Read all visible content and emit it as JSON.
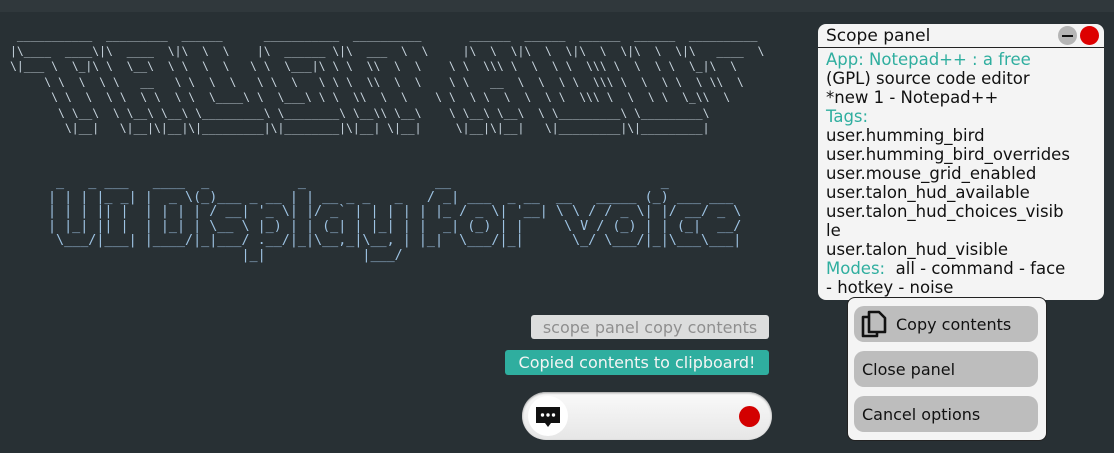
{
  "banner": {
    "title_art": [
      " ___________  _________  ______      ___________  __________       ______  ______  ______  ______  __________",
      "|\\____  ____\\|\\  ____  \\|\\  \\  \\    |\\  ______ \\|\\  ___  \\  \\     |\\  \\  \\|\\  \\  \\|\\  \\  \\|\\  \\  \\|\\   ____  \\",
      "\\|___ \\  \\_|\\ \\  \\__\\  \\ \\  \\  \\   \\ \\  \\___|\\ \\ \\  \\\\  \\  \\    \\ \\  \\\\\\ \\  \\  \\ \\  \\\\\\ \\  \\  \\ \\  \\_|\\  \\",
      "     \\ \\  \\  \\ \\   __   \\ \\  \\  \\   \\ \\  \\   \\ \\ \\  \\\\  \\  \\    \\ \\   __  \\  \\  \\ \\  \\\\\\ \\  \\  \\ \\  \\ \\\\  \\",
      "      \\ \\  \\  \\ \\  \\ \\  \\ \\  \\____\\ \\  \\___\\ \\ \\  \\\\  \\  \\    \\ \\  \\ \\  \\  \\  \\ \\  \\\\\\ \\  \\  \\ \\  \\_\\\\  \\",
      "       \\ \\__\\  \\ \\__\\ \\__\\ \\_________\\ \\________\\ \\__\\\\ \\__\\    \\ \\__\\ \\__\\  \\ \\_________\\ \\_________\\",
      "        \\|__|   \\|__|\\|__|\\|_________|\\|________|\\|__| \\|__|     \\|__|\\|__|   \\|_________|\\|_________|"
    ],
    "subtitle_art": [
      " _   _ ___   ____  _           _                __                          _          ",
      "| | | |_ _| |  _ \\(_)___ _ __ | | __ _ _   _   / _| ___  _ __  __   _____ (_) ___ ___ ",
      "| | | || |  | | | | / __| '_ \\| |/ _` | | | | | |_ / _ \\| '__| \\ \\ / / _ \\| |/ __/ _ \\",
      "| |_| || |  | |_| | \\__ \\ |_) | | (_| | |_| | |  _| (_) | |     \\ V / (_) | | (_|  __/",
      " \\___/|___| |____/|_|___/ .__/|_|\\__,_|\\__, | |_|  \\___/|_|      \\_/ \\___/|_|\\___\\___|",
      "                        |_|            |___/                                          "
    ]
  },
  "scope_panel": {
    "title": "Scope panel",
    "app_label": "App:",
    "app_value_part": "Notepad++ : a free",
    "app_line2": "(GPL) source code editor",
    "app_line3": "*new 1 - Notepad++",
    "tags_label": "Tags:",
    "tags": [
      "user.humming_bird",
      "user.humming_bird_overrides",
      "user.mouse_grid_enabled",
      "user.talon_hud_available",
      "user.talon_hud_choices_visib",
      "le",
      "user.talon_hud_visible"
    ],
    "modes_label": "Modes:",
    "modes_line1": "all - command - face",
    "modes_line2": "- hotkey - noise"
  },
  "options_menu": {
    "items": [
      "Copy contents",
      "Close panel",
      "Cancel options"
    ]
  },
  "notifications": {
    "command": "scope panel copy contents",
    "status": "Copied contents to clipboard!"
  },
  "colors": {
    "accent": "#2fae9f",
    "record": "#d30000",
    "background": "#283034"
  }
}
